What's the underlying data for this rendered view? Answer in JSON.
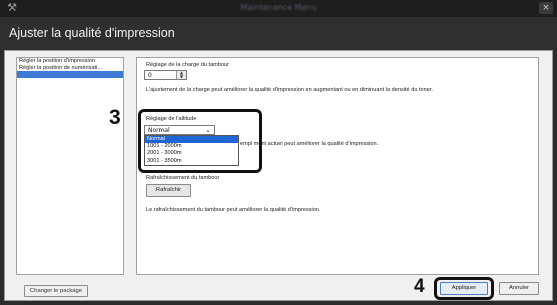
{
  "window": {
    "app_icon": "tools-icon",
    "title": "Maintenance Menu",
    "close_glyph": "×"
  },
  "header": {
    "title": "Ajuster la qualité d'impression"
  },
  "sidebar": {
    "items": [
      {
        "label": "Régler la position d'impression"
      },
      {
        "label": "Régler la position de numérisati..."
      },
      {
        "label": "Ajuster la qualité d'impression",
        "selected": true
      }
    ]
  },
  "panel": {
    "drum_charge": {
      "label": "Réglage de la charge du tambour",
      "value": "0",
      "description": "L'ajustement de la charge peut améliorer la qualité d'impression en augmentant ou en diminuant la densité du toner."
    },
    "altitude": {
      "label": "Réglage de l'altitude",
      "selected": "Normal",
      "options": [
        "Normal",
        "1001 - 2000m",
        "2001 - 3000m",
        "3001 - 3500m"
      ],
      "description_partial": "empl ment actuel peut améliorer la qualité d'impression."
    },
    "drum_refresh": {
      "label": "Rafraîchissement du tambour",
      "button": "Rafraîchir",
      "description": "Le rafraîchissement du tambour peut améliorer la qualité d'impression."
    }
  },
  "footer": {
    "package_button": "Changer le package",
    "apply_button": "Appliquer",
    "cancel_button": "Annuler"
  },
  "callouts": {
    "step_3": "3",
    "step_4": "4"
  }
}
